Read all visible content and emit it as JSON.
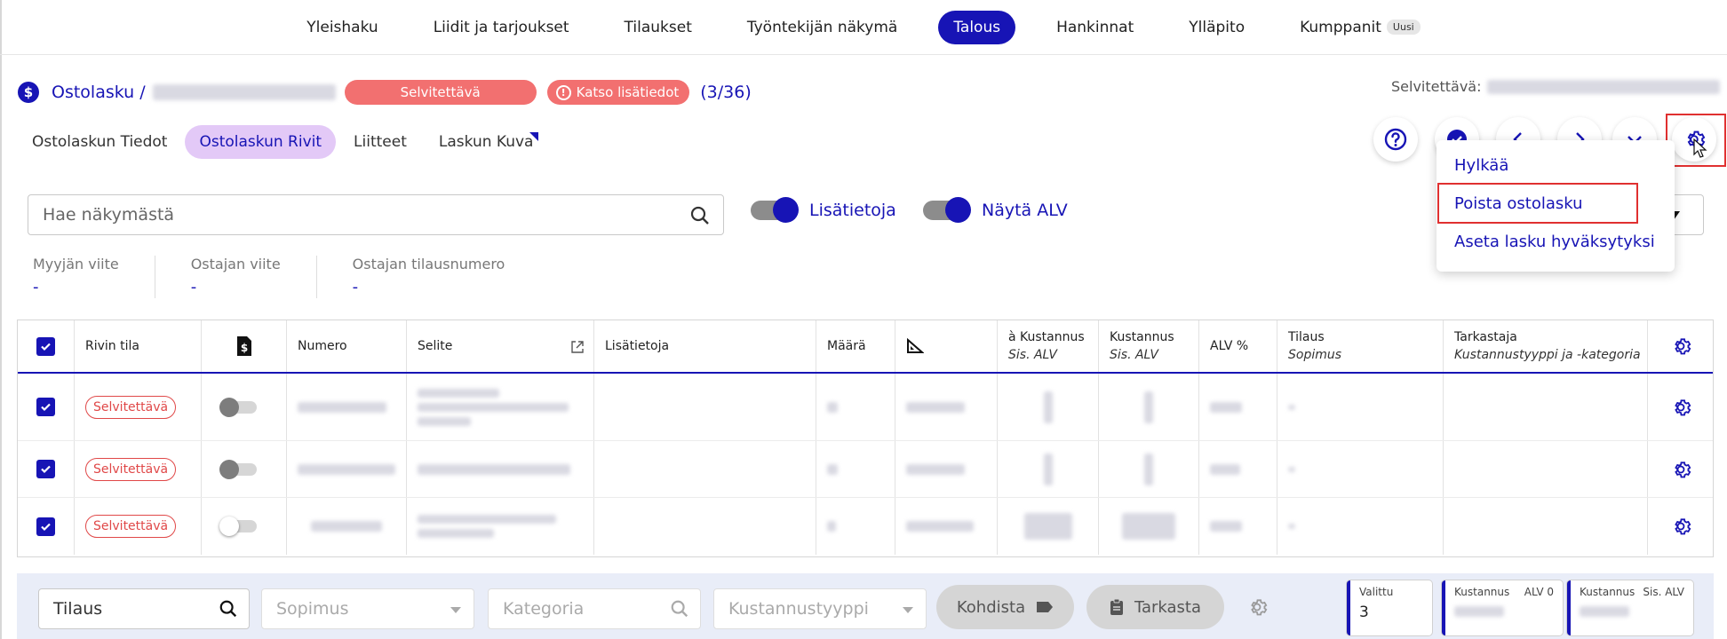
{
  "nav": {
    "items": [
      "Yleishaku",
      "Liidit ja tarjoukset",
      "Tilaukset",
      "Työntekijän näkymä",
      "Talous",
      "Hankinnat",
      "Ylläpito",
      "Kumppanit"
    ],
    "active": "Talous",
    "new_badge": "Uusi"
  },
  "header": {
    "breadcrumb": "Ostolasku /",
    "status": "Selvitettävä",
    "info_button": "Katso lisätiedot",
    "counter": "(3/36)",
    "status_right_label": "Selvitettävä:"
  },
  "tabs": [
    "Ostolaskun Tiedot",
    "Ostolaskun Rivit",
    "Liitteet",
    "Laskun Kuva"
  ],
  "active_tab": "Ostolaskun Rivit",
  "search": {
    "placeholder": "Hae näkymästä"
  },
  "toggles": {
    "lisatietoja": "Lisätietoja",
    "nayta_alv": "Näytä ALV"
  },
  "refs": [
    {
      "label": "Myyjän viite",
      "value": "-"
    },
    {
      "label": "Ostajan viite",
      "value": "-"
    },
    {
      "label": "Ostajan tilausnumero",
      "value": "-"
    }
  ],
  "table": {
    "headers": {
      "rivin_tila": "Rivin tila",
      "numero": "Numero",
      "selite": "Selite",
      "lisatietoja": "Lisätietoja",
      "maara": "Määrä",
      "a_kustannus": "à Kustannus",
      "a_kustannus_sub": "Sis. ALV",
      "kustannus": "Kustannus",
      "kustannus_sub": "Sis. ALV",
      "alv": "ALV %",
      "tilaus": "Tilaus",
      "tilaus_sub": "Sopimus",
      "tarkastaja": "Tarkastaja",
      "tarkastaja_sub": "Kustannustyyppi ja -kategoria"
    },
    "rows": [
      {
        "status": "Selvitettävä",
        "toggle_on": false
      },
      {
        "status": "Selvitettävä",
        "toggle_on": false
      },
      {
        "status": "Selvitettävä",
        "toggle_on": false
      }
    ]
  },
  "dropdown": {
    "items": [
      "Hylkää",
      "Poista ostolasku",
      "Aseta lasku hyväksytyksi"
    ]
  },
  "bottom": {
    "tilaus_placeholder": "Tilaus",
    "sopimus_placeholder": "Sopimus",
    "kategoria_placeholder": "Kategoria",
    "kustannustyyppi_placeholder": "Kustannustyyppi",
    "kohdista": "Kohdista",
    "tarkasta": "Tarkasta",
    "valittu_label": "Valittu",
    "valittu_value": "3",
    "kustannus_label": "Kustannus",
    "alv0_label": "ALV 0",
    "sis_alv_label": "Sis. ALV"
  },
  "colors": {
    "accent": "#1714b5",
    "status_red": "#f27070",
    "tab_active": "#e3c9f7"
  }
}
